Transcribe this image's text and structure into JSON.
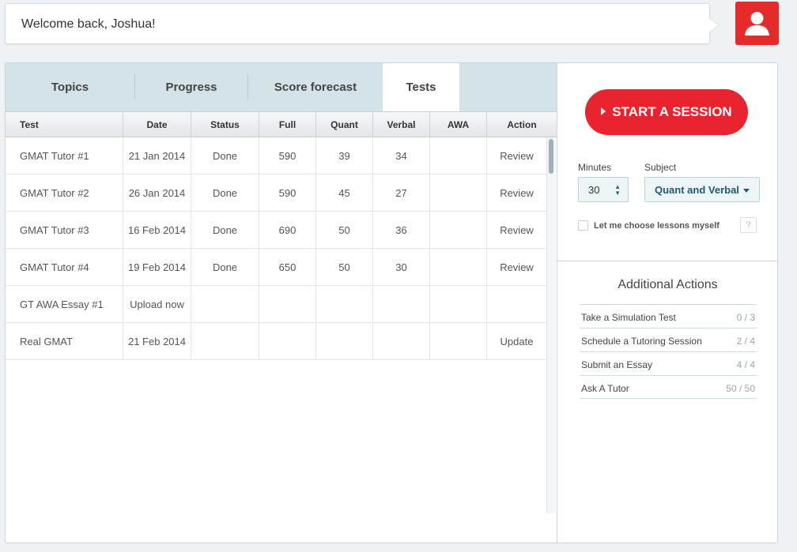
{
  "header": {
    "welcome": "Welcome back, Joshua!"
  },
  "tabs": [
    {
      "label": "Topics"
    },
    {
      "label": "Progress"
    },
    {
      "label": "Score forecast"
    },
    {
      "label": "Tests"
    }
  ],
  "table": {
    "columns": [
      "Test",
      "Date",
      "Status",
      "Full",
      "Quant",
      "Verbal",
      "AWA",
      "Action"
    ],
    "rows": [
      {
        "test": "GMAT Tutor #1",
        "date": "21 Jan 2014",
        "status": "Done",
        "full": "590",
        "quant": "39",
        "verbal": "34",
        "awa": "",
        "action": "Review"
      },
      {
        "test": "GMAT Tutor #2",
        "date": "26 Jan 2014",
        "status": "Done",
        "full": "590",
        "quant": "45",
        "verbal": "27",
        "awa": "",
        "action": "Review"
      },
      {
        "test": "GMAT Tutor #3",
        "date": "16 Feb 2014",
        "status": "Done",
        "full": "690",
        "quant": "50",
        "verbal": "36",
        "awa": "",
        "action": "Review"
      },
      {
        "test": "GMAT Tutor #4",
        "date": "19 Feb 2014",
        "status": "Done",
        "full": "650",
        "quant": "50",
        "verbal": "30",
        "awa": "",
        "action": "Review"
      },
      {
        "test": "GT AWA Essay #1",
        "date": "Upload now",
        "status": "",
        "full": "",
        "quant": "",
        "verbal": "",
        "awa": "",
        "action": ""
      },
      {
        "test": "Real GMAT",
        "date": "21 Feb 2014",
        "status": "",
        "full": "",
        "quant": "",
        "verbal": "",
        "awa": "",
        "action": "Update"
      }
    ]
  },
  "session": {
    "start_label": "START A SESSION",
    "minutes_label": "Minutes",
    "minutes_value": "30",
    "subject_label": "Subject",
    "subject_value": "Quant and Verbal",
    "choose_label": "Let me choose lessons myself",
    "help_label": "?"
  },
  "additional": {
    "title": "Additional Actions",
    "items": [
      {
        "label": "Take a Simulation Test",
        "count": "0 / 3"
      },
      {
        "label": "Schedule a Tutoring Session",
        "count": "2 / 4"
      },
      {
        "label": "Submit an Essay",
        "count": "4 / 4"
      },
      {
        "label": "Ask A Tutor",
        "count": "50 / 50"
      }
    ]
  },
  "colors": {
    "accent": "#e8232e",
    "tabs_bg": "#d3e3e8"
  }
}
